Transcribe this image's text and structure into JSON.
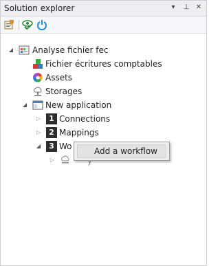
{
  "window": {
    "title": "Solution explorer",
    "controls": {
      "dropdown": "▾",
      "pin": "⊥",
      "close": "✕"
    }
  },
  "toolbar": {
    "buttons": [
      {
        "name": "properties-button",
        "icon": "properties-icon"
      },
      {
        "name": "check-button",
        "icon": "eye-check-icon"
      },
      {
        "name": "power-button",
        "icon": "power-icon"
      }
    ]
  },
  "tree": {
    "root": {
      "label": "Analyse fichier fec",
      "icon": "solution-icon",
      "expanded": true,
      "children": [
        {
          "label": "Fichier écritures comptables",
          "icon": "blocks-icon"
        },
        {
          "label": "Assets",
          "icon": "color-wheel-icon"
        },
        {
          "label": "Storages",
          "icon": "cloud-storage-icon"
        }
      ]
    },
    "application": {
      "label": "New application",
      "icon": "application-icon",
      "expanded": true,
      "children": [
        {
          "badge": "1",
          "label": "Connections",
          "expanded": false
        },
        {
          "badge": "2",
          "label": "Mappings",
          "expanded": false
        },
        {
          "badge": "3",
          "label": "Wo",
          "expanded": true
        }
      ]
    },
    "workflow_child": {
      "icon": "workflow-icon",
      "label": "y"
    }
  },
  "context_menu": {
    "items": [
      {
        "label": "Add a workflow"
      }
    ]
  },
  "colors": {
    "title_bg": "#eeeef2",
    "toolbar_bg": "#f7f7f9",
    "badge_bg": "#2d2d2d",
    "menu_bg": "#f0f0f0"
  }
}
